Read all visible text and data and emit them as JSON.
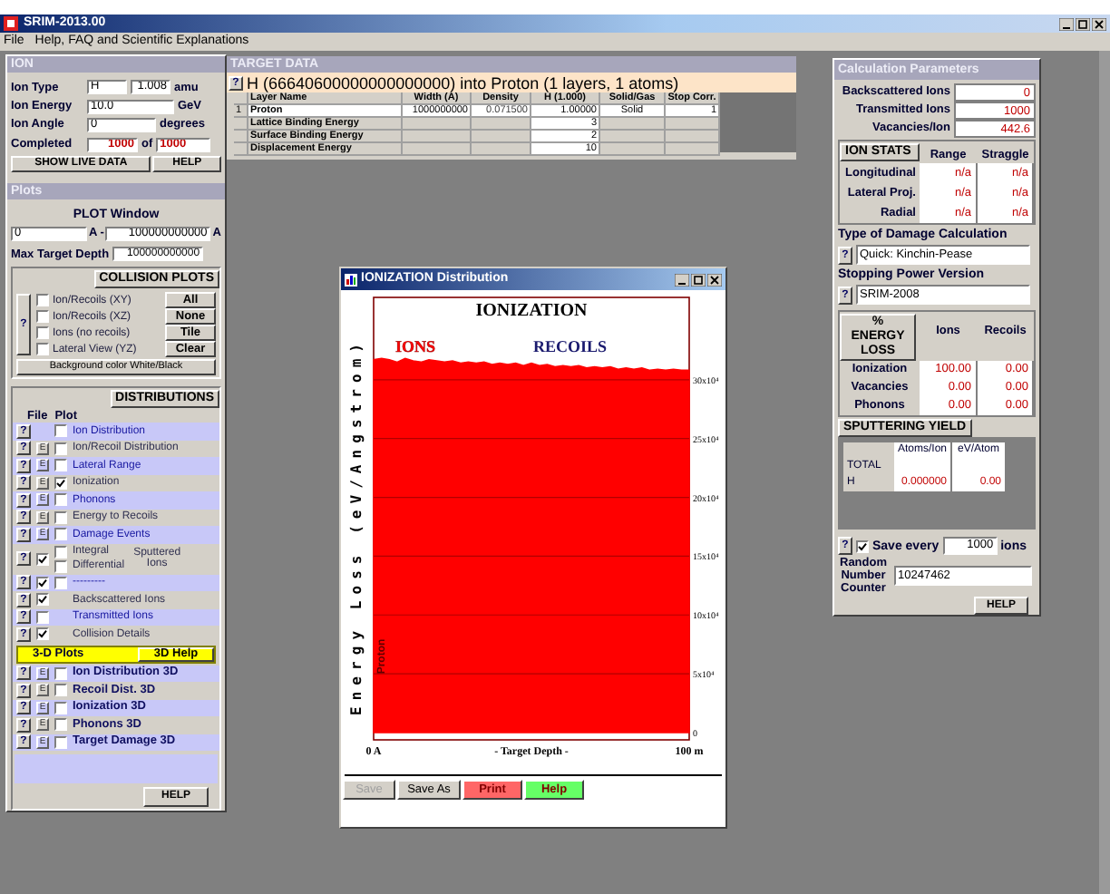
{
  "window": {
    "title": "SRIM-2013.00"
  },
  "menu": [
    "File",
    "Help, FAQ and Scientific Explanations"
  ],
  "ion": {
    "header": "ION",
    "type_label": "Ion Type",
    "type": "H",
    "mass": "1.008",
    "mass_unit": "amu",
    "energy_label": "Ion Energy",
    "energy": "10.0",
    "energy_unit": "GeV",
    "angle_label": "Ion Angle",
    "angle": "0",
    "angle_unit": "degrees",
    "completed_label": "Completed",
    "completed": "1000",
    "of": "of",
    "total": "1000",
    "buttons": [
      "SHOW LIVE DATA",
      "HELP"
    ]
  },
  "plots": {
    "header": "Plots",
    "window_title": "PLOT Window",
    "from": "0",
    "from_unit": "A -",
    "to": "100000000000",
    "to_unit": "A",
    "max_depth_label": "Max Target Depth",
    "max_depth": "100000000000",
    "collision_title": "COLLISION PLOTS",
    "help": "?",
    "collision_items": [
      {
        "label": "Ion/Recoils (XY)",
        "checked": false
      },
      {
        "label": "Ion/Recoils (XZ)",
        "checked": false
      },
      {
        "label": "Ions (no recoils)",
        "checked": false
      },
      {
        "label": "Lateral View (YZ)",
        "checked": false
      }
    ],
    "collision_buttons": [
      "All",
      "None",
      "Tile",
      "Clear"
    ],
    "background_button": "Background color White/Black"
  },
  "distributions": {
    "title": "DISTRIBUTIONS",
    "file_header": "File",
    "plot_header": "Plot",
    "rows": [
      {
        "kind": "plot",
        "help": "?",
        "checked": false,
        "label": "Ion Distribution"
      },
      {
        "kind": "plot",
        "help": "?",
        "file_icon": "E",
        "checked": false,
        "label": "Ion/Recoil Distribution"
      },
      {
        "kind": "plot",
        "help": "?",
        "file_icon": "E",
        "checked": false,
        "label": "Lateral Range"
      },
      {
        "kind": "plot",
        "help": "?",
        "file_icon": "E",
        "checked": true,
        "label": "Ionization"
      },
      {
        "kind": "plot",
        "help": "?",
        "file_icon": "E",
        "checked": false,
        "label": "Phonons"
      },
      {
        "kind": "plot",
        "help": "?",
        "file_icon": "E",
        "checked": false,
        "label": "Energy to Recoils"
      },
      {
        "kind": "plot",
        "help": "?",
        "file_icon": "E",
        "checked": false,
        "label": "Damage Events"
      },
      {
        "kind": "sputtered",
        "help": "?",
        "file_checked": true,
        "options": [
          {
            "label": "Integral",
            "checked": false
          },
          {
            "label": "Differential",
            "checked": false
          }
        ],
        "label": "Sputtered Ions"
      },
      {
        "kind": "plot",
        "help": "?",
        "file_checked": true,
        "checked": false,
        "label": "---------"
      },
      {
        "kind": "plot",
        "help": "?",
        "file_checked": true,
        "label": "Backscattered Ions"
      },
      {
        "kind": "plot",
        "help": "?",
        "file_checked": false,
        "label": "Transmitted Ions"
      },
      {
        "kind": "plot",
        "help": "?",
        "file_checked": true,
        "label": "Collision Details"
      }
    ],
    "plots_3d_title": "3-D Plots",
    "plots_3d_help": "3D Help",
    "rows_3d": [
      {
        "help": "?",
        "file_icon": "E",
        "checked": false,
        "label": "Ion Distribution 3D"
      },
      {
        "help": "?",
        "file_icon": "E",
        "checked": false,
        "label": "Recoil Dist. 3D"
      },
      {
        "help": "?",
        "file_icon": "E",
        "checked": false,
        "label": "Ionization 3D"
      },
      {
        "help": "?",
        "file_icon": "E",
        "checked": false,
        "label": "Phonons 3D"
      },
      {
        "help": "?",
        "file_icon": "E",
        "checked": false,
        "label": "Target Damage 3D"
      }
    ],
    "help_button": "HELP"
  },
  "target": {
    "header": "TARGET DATA",
    "help": "?",
    "summary": "H (66640600000000000000) into Proton (1 layers, 1 atoms)",
    "columns": [
      "Layer Name",
      "Width (A)",
      "Density",
      "H (1.000)",
      "Solid/Gas",
      "Stop Corr."
    ],
    "rows": [
      {
        "index": "1",
        "cells": [
          "Proton",
          "1000000000",
          "0.071500",
          "1.00000",
          "Solid",
          "1"
        ]
      },
      {
        "cells": [
          "Lattice Binding Energy",
          "",
          "",
          "3",
          "",
          ""
        ]
      },
      {
        "cells": [
          "Surface Binding Energy",
          "",
          "",
          "2",
          "",
          ""
        ]
      },
      {
        "cells": [
          "Displacement Energy",
          "",
          "",
          "10",
          "",
          ""
        ]
      }
    ]
  },
  "calc": {
    "header": "Calculation Parameters",
    "stats": [
      {
        "label": "Backscattered Ions",
        "value": "0"
      },
      {
        "label": "Transmitted Ions",
        "value": "1000"
      },
      {
        "label": "Vacancies/Ion",
        "value": "442.6"
      }
    ],
    "ion_stats": {
      "title": "ION STATS",
      "columns": [
        "Range",
        "Straggle"
      ],
      "rows": [
        {
          "label": "Longitudinal",
          "values": [
            "n/a",
            "n/a"
          ]
        },
        {
          "label": "Lateral Proj.",
          "values": [
            "n/a",
            "n/a"
          ]
        },
        {
          "label": "Radial",
          "values": [
            "n/a",
            "n/a"
          ]
        }
      ]
    },
    "damage": {
      "title": "Type of Damage Calculation",
      "help": "?",
      "value": "Quick: Kinchin-Pease"
    },
    "stopping": {
      "title": "Stopping Power Version",
      "help": "?",
      "value": "SRIM-2008"
    },
    "energy_loss": {
      "title": "% ENERGY LOSS",
      "columns": [
        "Ions",
        "Recoils"
      ],
      "rows": [
        {
          "label": "Ionization",
          "values": [
            "100.00",
            "0.00"
          ]
        },
        {
          "label": "Vacancies",
          "values": [
            "0.00",
            "0.00"
          ]
        },
        {
          "label": "Phonons",
          "values": [
            "0.00",
            "0.00"
          ]
        }
      ]
    },
    "sputtering": {
      "title": "SPUTTERING YIELD",
      "columns": [
        "Atoms/Ion",
        "eV/Atom"
      ],
      "rows": [
        {
          "label": "TOTAL",
          "values": []
        },
        {
          "label": "H",
          "values": [
            "0.000000",
            "0.00"
          ]
        }
      ]
    },
    "save": {
      "help": "?",
      "checked": true,
      "label": "Save every",
      "value": "1000",
      "unit": "ions"
    },
    "random": {
      "label": "Random Number Counter",
      "value": "10247462"
    },
    "help_button": "HELP"
  },
  "plot_window": {
    "title": "IONIZATION Distribution",
    "chart_data": {
      "type": "area",
      "title": "IONIZATION",
      "xlabel": "- Target Depth -",
      "ylabel": "Energy Loss (eV/Angstrom)",
      "xlim": [
        0,
        100
      ],
      "ylim": [
        0,
        370000
      ],
      "xticks": [
        {
          "value": 0,
          "label": "0 A"
        },
        {
          "value": 100,
          "label": "100 m"
        }
      ],
      "grid": true,
      "x": [
        0,
        2.5,
        5,
        7.5,
        10,
        12.5,
        15,
        17.5,
        20,
        22.5,
        25,
        27.5,
        30,
        32.5,
        35,
        37.5,
        40,
        42.5,
        45,
        47.5,
        50,
        52.5,
        55,
        57.5,
        60,
        62.5,
        65,
        67.5,
        70,
        72.5,
        75,
        77.5,
        80,
        82.5,
        85,
        87.5,
        90,
        92.5,
        95,
        97.5,
        100
      ],
      "yticks": [
        {
          "value": 0,
          "label": "0"
        },
        {
          "value": 50000,
          "label": "5x10⁴"
        },
        {
          "value": 100000,
          "label": "10x10⁴"
        },
        {
          "value": 150000,
          "label": "15x10⁴"
        },
        {
          "value": 200000,
          "label": "20x10⁴"
        },
        {
          "value": 250000,
          "label": "25x10⁴"
        },
        {
          "value": 300000,
          "label": "30x10⁴"
        }
      ],
      "series": [
        {
          "name": "IONS",
          "color": "#ff0000",
          "values": [
            317000,
            318000,
            317000,
            315000,
            318000,
            316000,
            315000,
            317000,
            316000,
            315000,
            316000,
            314000,
            315000,
            314000,
            315000,
            313000,
            314000,
            313000,
            314000,
            312000,
            314000,
            312000,
            313000,
            311000,
            312000,
            311000,
            312000,
            310000,
            311000,
            310000,
            311000,
            309000,
            310000,
            309000,
            310000,
            308000,
            309000,
            308000,
            309000,
            308000,
            308000
          ]
        },
        {
          "name": "RECOILS",
          "color": "#1a1a6e",
          "values": [
            null,
            null,
            null,
            null,
            null,
            null,
            null,
            null,
            null,
            null,
            null,
            null,
            null,
            null,
            null,
            null,
            null,
            null,
            null,
            null,
            null,
            null,
            null,
            null,
            null,
            null,
            null,
            null,
            null,
            null,
            null,
            null,
            null,
            null,
            null,
            null,
            null,
            null,
            null,
            null,
            null
          ]
        }
      ],
      "annotations": [
        "Proton"
      ]
    },
    "buttons": [
      {
        "label": "Save",
        "kind": "plain",
        "disabled": true
      },
      {
        "label": "Save As",
        "kind": "plain",
        "disabled": false
      },
      {
        "label": "Print",
        "kind": "red",
        "disabled": false
      },
      {
        "label": "Help",
        "kind": "green",
        "disabled": false
      }
    ]
  }
}
